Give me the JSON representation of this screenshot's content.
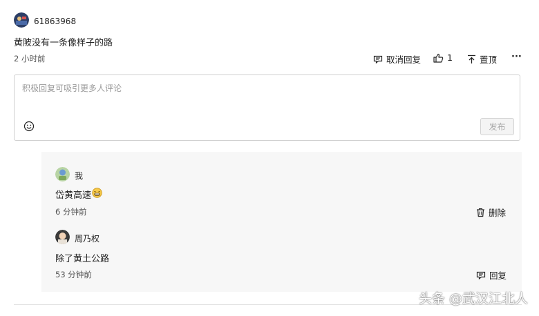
{
  "comment": {
    "username": "61863968",
    "text": "黄陂没有一条像样子的路",
    "time": "2 小时前",
    "actions": {
      "cancel_reply": "取消回复",
      "like_count": "1",
      "pin": "置顶",
      "more": "···"
    }
  },
  "reply_box": {
    "placeholder": "积极回复可吸引更多人评论",
    "emoji_icon": "smiley-icon",
    "publish_label": "发布"
  },
  "replies": [
    {
      "username": "我",
      "text": "岱黄高速",
      "emoji": "grin-emoji",
      "time": "6 分钟前",
      "action": "删除",
      "action_icon": "trash-icon"
    },
    {
      "username": "周乃权",
      "text": "除了黄土公路",
      "time": "53 分钟前",
      "action": "回复",
      "action_icon": "reply-icon"
    }
  ],
  "watermark": "头条 @武汉江北人"
}
